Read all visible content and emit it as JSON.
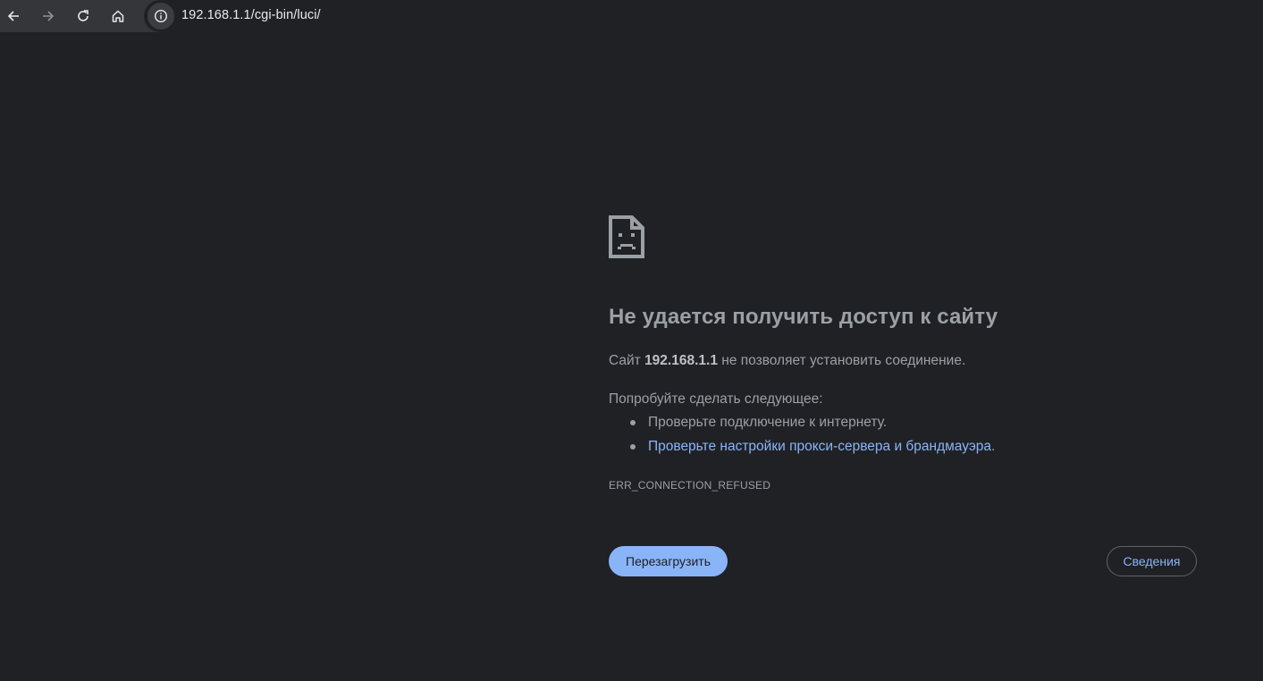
{
  "browser": {
    "url": "192.168.1.1/cgi-bin/luci/",
    "icons": [
      "back-icon",
      "forward-icon",
      "reload-icon",
      "home-icon",
      "info-icon"
    ]
  },
  "error": {
    "icon": "sad-page-icon",
    "title": "Не удается получить доступ к сайту",
    "desc_prefix": "Сайт ",
    "host": "192.168.1.1",
    "desc_suffix": " не позволяет установить соединение.",
    "suggest_heading": "Попробуйте сделать следующее:",
    "suggestions": [
      {
        "text": "Проверьте подключение к интернету.",
        "suffix": ""
      },
      {
        "text": "Проверьте настройки прокси-сервера и брандмауэра",
        "suffix": "."
      }
    ],
    "code": "ERR_CONNECTION_REFUSED",
    "reload_label": "Перезагрузить",
    "details_label": "Сведения"
  },
  "colors": {
    "background": "#202124",
    "toolbar": "#35363a",
    "text": "#9aa0a6",
    "accent": "#8ab4f8"
  }
}
